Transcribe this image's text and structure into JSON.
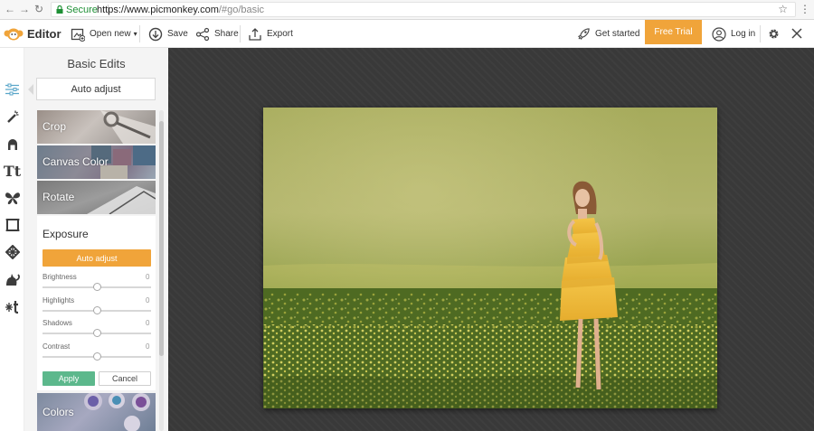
{
  "browser": {
    "secure_label": "Secure",
    "url_main": "https://www.picmonkey.com",
    "url_rest": "/#go/basic"
  },
  "app": {
    "editor_label": "Editor"
  },
  "toolbar": {
    "open_new": "Open new",
    "save": "Save",
    "share": "Share",
    "export": "Export",
    "get_started": "Get started",
    "free_trial": "Free Trial",
    "log_in": "Log in"
  },
  "rail": {
    "text_tool_glyph": "Tt"
  },
  "panel": {
    "title": "Basic Edits",
    "auto_adjust": "Auto adjust",
    "tools": [
      {
        "label": "Crop"
      },
      {
        "label": "Canvas Color"
      },
      {
        "label": "Rotate"
      }
    ],
    "exposure": {
      "title": "Exposure",
      "auto_adjust": "Auto adjust",
      "sliders": [
        {
          "label": "Brightness",
          "value": "0"
        },
        {
          "label": "Highlights",
          "value": "0"
        },
        {
          "label": "Shadows",
          "value": "0"
        },
        {
          "label": "Contrast",
          "value": "0"
        }
      ],
      "apply": "Apply",
      "cancel": "Cancel"
    },
    "colors_label": "Colors"
  },
  "colors": {
    "accent_orange": "#f0a43a",
    "apply_green": "#5cb88c",
    "canvas_bg": "#393939",
    "secure_green": "#1e8f35"
  }
}
